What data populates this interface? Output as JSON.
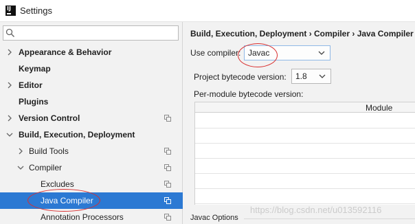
{
  "window": {
    "title": "Settings"
  },
  "search": {
    "placeholder": ""
  },
  "tree": {
    "items": [
      {
        "label": "Appearance & Behavior"
      },
      {
        "label": "Keymap"
      },
      {
        "label": "Editor"
      },
      {
        "label": "Plugins"
      },
      {
        "label": "Version Control"
      },
      {
        "label": "Build, Execution, Deployment"
      },
      {
        "label": "Build Tools"
      },
      {
        "label": "Compiler"
      },
      {
        "label": "Excludes"
      },
      {
        "label": "Java Compiler"
      },
      {
        "label": "Annotation Processors"
      }
    ]
  },
  "main": {
    "breadcrumb": "Build, Execution, Deployment › Compiler › Java Compiler",
    "use_compiler": {
      "label": "Use compiler:",
      "value": "Javac"
    },
    "bytecode": {
      "label": "Project bytecode version:",
      "value": "1.8"
    },
    "per_module_label": "Per-module bytecode version:",
    "table": {
      "column": "Module"
    },
    "javac_options_label": "Javac Options"
  },
  "watermark": "https://blog.csdn.net/u013592116",
  "colors": {
    "selection": "#2c79d3",
    "annotation": "#d92e2e"
  }
}
